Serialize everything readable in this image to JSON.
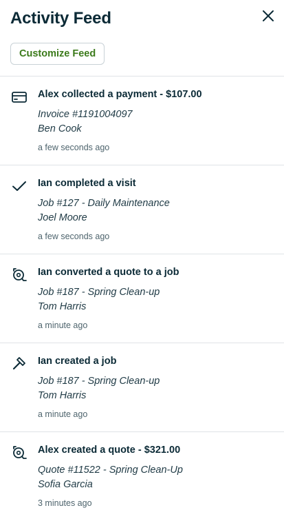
{
  "header": {
    "title": "Activity Feed",
    "close_icon": "close-icon",
    "customize_label": "Customize Feed"
  },
  "colors": {
    "text": "#0b2a36",
    "accent_green": "#3b7a1a",
    "divider": "#dfe3e6"
  },
  "feed": [
    {
      "icon": "credit-card-icon",
      "headline": "Alex collected a payment - $107.00",
      "line1": "Invoice #1191004097",
      "line2": "Ben Cook",
      "time": "a few seconds ago"
    },
    {
      "icon": "checkmark-icon",
      "headline": "Ian completed a visit",
      "line1": "Job #127 - Daily Maintenance",
      "line2": "Joel Moore",
      "time": "a few seconds ago"
    },
    {
      "icon": "quote-icon",
      "headline": "Ian converted a quote to a job",
      "line1": "Job #187 - Spring Clean-up",
      "line2": "Tom Harris",
      "time": "a minute ago"
    },
    {
      "icon": "hammer-icon",
      "headline": "Ian created a job",
      "line1": "Job #187 - Spring Clean-up",
      "line2": "Tom Harris",
      "time": "a minute ago"
    },
    {
      "icon": "quote-icon",
      "headline": "Alex created a quote - $321.00",
      "line1": "Quote #11522 - Spring Clean-Up",
      "line2": "Sofia Garcia",
      "time": "3 minutes ago"
    }
  ]
}
